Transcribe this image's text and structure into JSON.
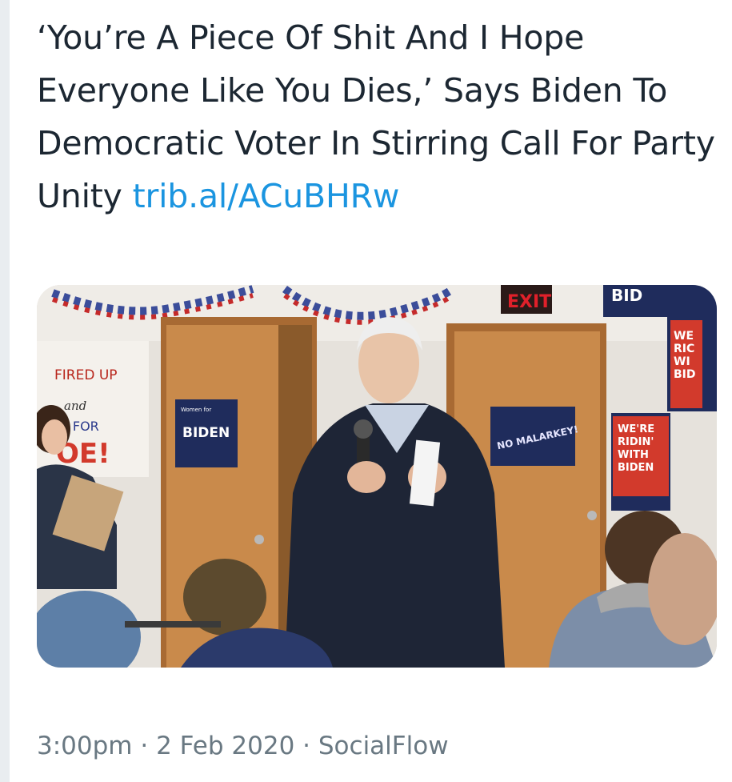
{
  "tweet": {
    "text": "‘You’re A Piece Of Shit And I Hope Everyone Like You Dies,’ Says Biden To Democratic Voter In Stirring Call For Party Unity",
    "link": "trib.al/ACuBHRw"
  },
  "photo": {
    "exit_sign": "EXIT",
    "poster_fired_up": "FIRED UP",
    "poster_and": "and",
    "poster_ready_for": "Y FOR",
    "poster_joe": "OE!",
    "door_sign_biden": "BIDEN",
    "door_sign_biden_top": "Women for",
    "door_sign_malarkey": "NO MALARKEY!",
    "sign_ridin": [
      "WE'RE",
      "RIDIN'",
      "WITH",
      "BIDEN"
    ],
    "sign_we_ride": [
      "WE",
      "RIC",
      "WI",
      "BID"
    ],
    "banner_top": "BID",
    "colors": {
      "wall": "#e6e2dc",
      "door": "#c98a4b",
      "sign_navy": "#1f2c5c",
      "sign_red": "#d23a2c",
      "exit_red": "#e0202a"
    }
  },
  "meta": {
    "time": "3:00pm",
    "separator": "·",
    "date": "2 Feb 2020",
    "source": "SocialFlow"
  }
}
